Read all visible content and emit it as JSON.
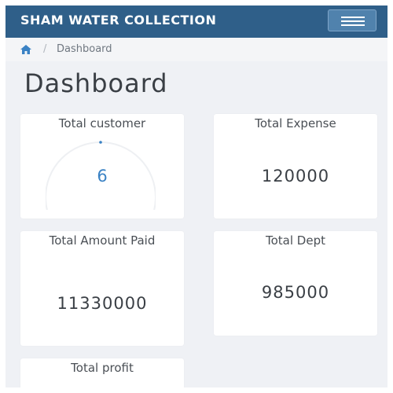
{
  "navbar": {
    "brand": "SHAM WATER COLLECTION",
    "menu_icon": "hamburger-menu-icon",
    "background": "#2f5f89"
  },
  "breadcrumb": {
    "home_icon": "home-icon",
    "separator": "/",
    "current": "Dashboard"
  },
  "page": {
    "title": "Dashboard"
  },
  "cards": {
    "total_customer": {
      "title": "Total customer",
      "value": "6"
    },
    "total_expense": {
      "title": "Total Expense",
      "value": "120000"
    },
    "total_amount_paid": {
      "title": "Total Amount Paid",
      "value": "11330000"
    },
    "total_dept": {
      "title": "Total Dept",
      "value": "985000"
    },
    "total_profit": {
      "title": "Total profit"
    }
  },
  "colors": {
    "accent": "#3a82c4",
    "background": "#eff1f5"
  }
}
